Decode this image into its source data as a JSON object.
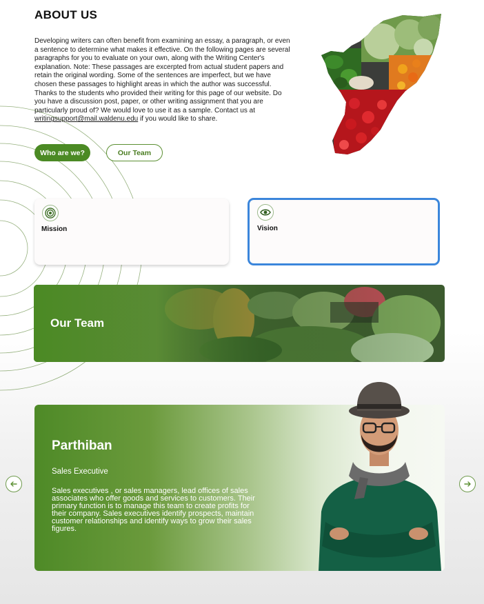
{
  "about": {
    "title": "ABOUT US",
    "body_before_link": "Developing writers can often benefit from examining an essay, a paragraph, or even a sentence to determine what makes it effective. On the following pages are several paragraphs for you to evaluate on your own, along with the Writing Center's explanation. Note: These passages are excerpted from actual student papers and retain the original wording. Some of the sentences are imperfect, but we have chosen these passages to highlight areas in which the author was successful. Thanks to the students who provided their writing for this page of our website. Do you have a discussion post, paper, or other writing assignment that you are particularly proud of? We would love to use it as a sample. Contact us at ",
    "email": "writingsupport@mail.waldenu.edu",
    "body_after_link": " if you would like to share.",
    "buttons": {
      "primary": "Who are we?",
      "secondary": "Our Team"
    }
  },
  "cards": {
    "mission": "Mission",
    "vision": "Vision"
  },
  "team": {
    "title": "Our Team"
  },
  "profile": {
    "name": "Parthiban",
    "role": "Sales Executive",
    "description": "Sales executives , or sales managers, lead offices of sales associates who offer goods and services to customers. Their primary function is to manage this team to create profits for their company. Sales executives identify prospects, maintain customer relationships and identify ways to grow their sales figures."
  },
  "icons": {
    "mission": "target-icon",
    "vision": "eye-icon",
    "prev": "arrow-left-icon",
    "next": "arrow-right-icon"
  },
  "colors": {
    "brand_green": "#4b8a24",
    "vision_border": "#3b86db",
    "icon_green": "#3f6f28"
  }
}
